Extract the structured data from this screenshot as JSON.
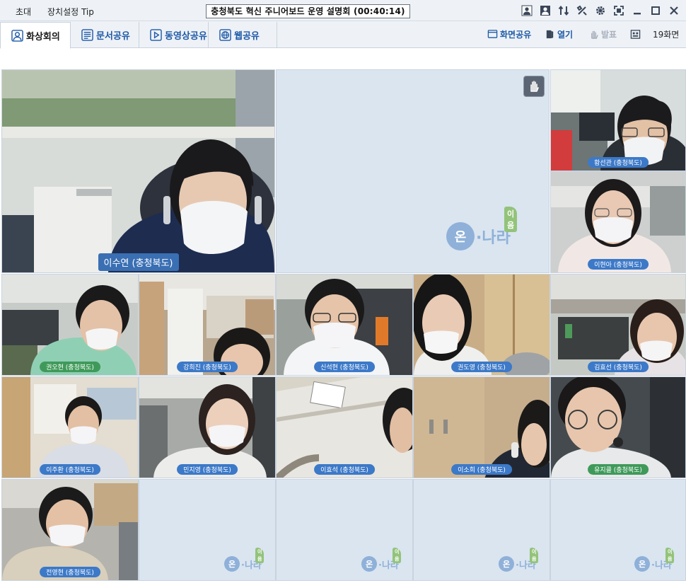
{
  "menu": {
    "invite": "초대",
    "device_tip": "장치설정 Tip"
  },
  "window": {
    "title": "충청북도 혁신 주니어보드 운영 설명회 (00:40:14)"
  },
  "top_icons": [
    "participant-icon",
    "user-icon",
    "transfer-icon",
    "tools-icon",
    "settings-icon",
    "fullscreen-icon",
    "minimize-icon",
    "maximize-icon",
    "close-icon"
  ],
  "tabs": [
    {
      "label": "화상회의",
      "icon": "video-conference-icon",
      "active": true
    },
    {
      "label": "문서공유",
      "icon": "document-icon",
      "active": false
    },
    {
      "label": "동영상공유",
      "icon": "play-icon",
      "active": false
    },
    {
      "label": "웹공유",
      "icon": "globe-icon",
      "active": false
    }
  ],
  "right_tools": {
    "screen_share": "화면공유",
    "open": "열기",
    "presentation": "발표",
    "screens": "19화면"
  },
  "logo": {
    "on": "온",
    "nara": "·나라",
    "ium": "이음"
  },
  "participants": [
    {
      "name": "이수연 (충청북도)"
    },
    {
      "name": "황선관 (충청북도)"
    },
    {
      "name": "이현아 (충청북도)"
    },
    {
      "name": "권오현 (충청북도)"
    },
    {
      "name": "강희진 (충청북도)"
    },
    {
      "name": "신석현 (충청북도)"
    },
    {
      "name": "권도영 (충청북도)"
    },
    {
      "name": "김효선 (충청북도)"
    },
    {
      "name": "이주환 (충청북도)"
    },
    {
      "name": "민지영 (충청북도)"
    },
    {
      "name": "이효석 (충청북도)"
    },
    {
      "name": "이소희 (충청북도)"
    },
    {
      "name": "유지클 (충청북도)"
    },
    {
      "name": "전영현 (충청북도)"
    }
  ],
  "colors": {
    "label_blue": "#3c79c8",
    "label_green": "#3f9a5a",
    "empty_tile": "#dae5f0",
    "tab_text": "#1f5aa6"
  }
}
